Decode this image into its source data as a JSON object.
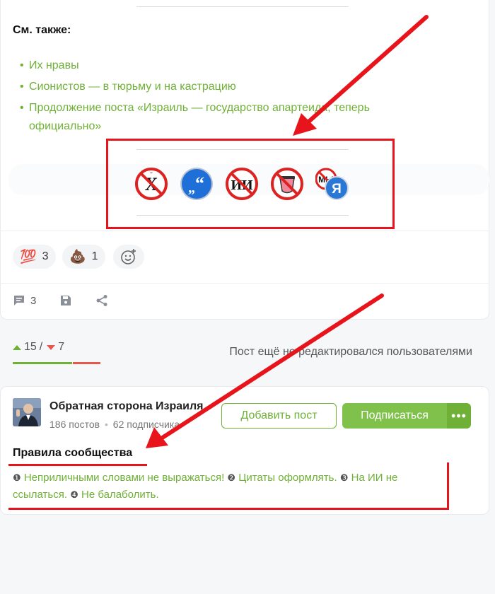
{
  "post": {
    "see_also_title": "См. также:",
    "links": [
      {
        "label": "Их нравы"
      },
      {
        "label": "Сионистов — в тюрьму и на кастрацию"
      },
      {
        "label": "Продолжение поста «Израиль — государство апартеида, теперь официально»"
      }
    ],
    "rule_icons": [
      {
        "name": "no-swearing-icon"
      },
      {
        "name": "quotes-icon"
      },
      {
        "name": "no-ai-icon"
      },
      {
        "name": "no-chatter-icon"
      },
      {
        "name": "we-me-icon"
      }
    ]
  },
  "reactions": [
    {
      "emoji": "💯",
      "count": "3"
    },
    {
      "emoji": "💩",
      "count": "1"
    }
  ],
  "actions": {
    "comments_count": "3"
  },
  "rating": {
    "up": "15",
    "separator": "/",
    "down": "7",
    "edit_note": "Пост ещё не редактировался пользователями"
  },
  "community": {
    "name": "Обратная сторона Израиля",
    "posts": "186 постов",
    "separator": "•",
    "subscribers": "62 подписчика",
    "add_post_label": "Добавить пост",
    "subscribe_label": "Подписаться",
    "more_label": "•••",
    "rules_title": "Правила сообщества",
    "rules": [
      {
        "num": "❶",
        "text": "Неприличными словами не выражаться!"
      },
      {
        "num": "❷",
        "text": "Цитаты оформлять."
      },
      {
        "num": "❸",
        "text": "На ИИ не ссылаться."
      },
      {
        "num": "❹",
        "text": "Не балаболить."
      }
    ]
  },
  "colors": {
    "accent_green": "#6fb136",
    "annotation_red": "#e8141b",
    "down_red": "#e8574b"
  }
}
